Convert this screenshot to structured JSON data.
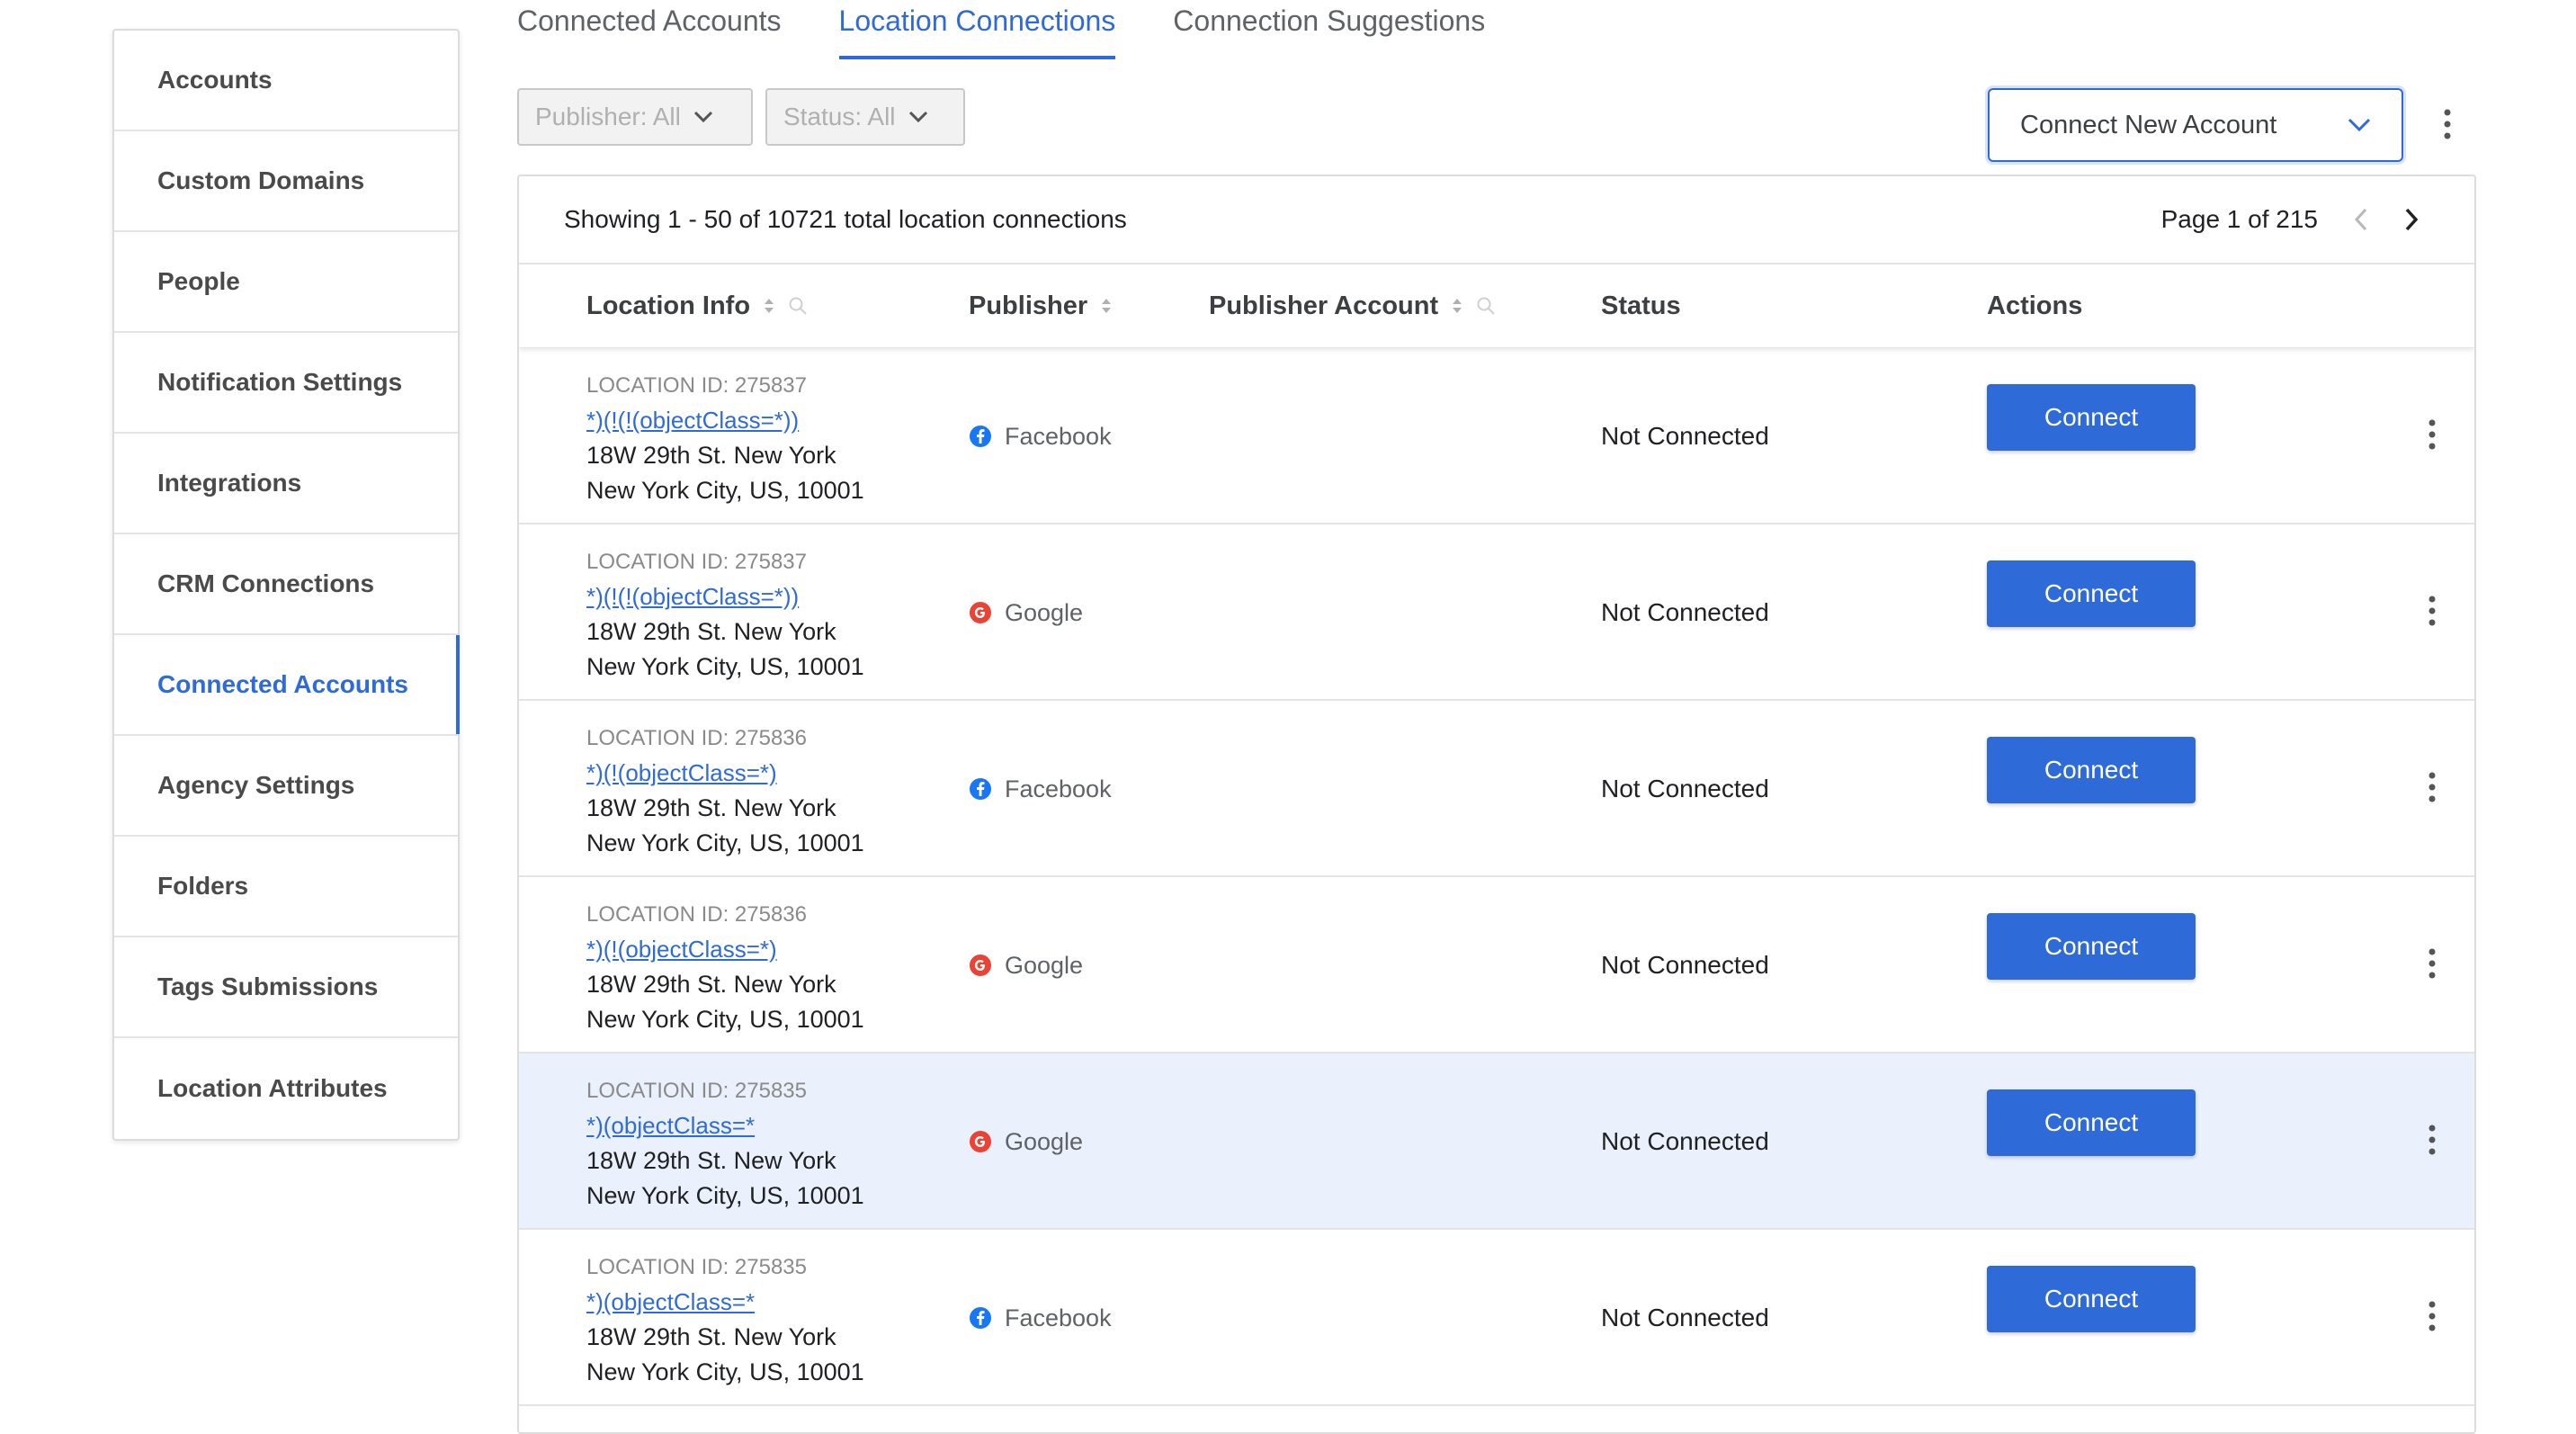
{
  "sidebar": {
    "items": [
      {
        "label": "Accounts"
      },
      {
        "label": "Custom Domains"
      },
      {
        "label": "People"
      },
      {
        "label": "Notification Settings"
      },
      {
        "label": "Integrations"
      },
      {
        "label": "CRM Connections"
      },
      {
        "label": "Connected Accounts",
        "active": true
      },
      {
        "label": "Agency Settings"
      },
      {
        "label": "Folders"
      },
      {
        "label": "Tags Submissions"
      },
      {
        "label": "Location Attributes"
      }
    ]
  },
  "tabs": [
    {
      "label": "Connected Accounts"
    },
    {
      "label": "Location Connections",
      "active": true
    },
    {
      "label": "Connection Suggestions"
    }
  ],
  "filters": {
    "publisher": "Publisher: All",
    "status": "Status: All"
  },
  "connect_new_label": "Connect New Account",
  "summary": {
    "showing": "Showing 1 - 50 of 10721 total location connections",
    "page": "Page 1 of 215"
  },
  "columns": {
    "location_info": "Location Info",
    "publisher": "Publisher",
    "publisher_account": "Publisher Account",
    "status": "Status",
    "actions": "Actions"
  },
  "rows": [
    {
      "loc_id": "LOCATION ID: 275837",
      "link": "*)(!(!(objectClass=*))",
      "addr1": "18W 29th St. New York",
      "addr2": "New York City, US, 10001",
      "publisher": "Facebook",
      "status": "Not Connected",
      "action": "Connect"
    },
    {
      "loc_id": "LOCATION ID: 275837",
      "link": "*)(!(!(objectClass=*))",
      "addr1": "18W 29th St. New York",
      "addr2": "New York City, US, 10001",
      "publisher": "Google",
      "status": "Not Connected",
      "action": "Connect"
    },
    {
      "loc_id": "LOCATION ID: 275836",
      "link": "*)(!(objectClass=*)",
      "addr1": "18W 29th St. New York",
      "addr2": "New York City, US, 10001",
      "publisher": "Facebook",
      "status": "Not Connected",
      "action": "Connect"
    },
    {
      "loc_id": "LOCATION ID: 275836",
      "link": "*)(!(objectClass=*)",
      "addr1": "18W 29th St. New York",
      "addr2": "New York City, US, 10001",
      "publisher": "Google",
      "status": "Not Connected",
      "action": "Connect"
    },
    {
      "loc_id": "LOCATION ID: 275835",
      "link": "*)(objectClass=*",
      "addr1": "18W 29th St. New York",
      "addr2": "New York City, US, 10001",
      "publisher": "Google",
      "status": "Not Connected",
      "action": "Connect",
      "highlighted": true
    },
    {
      "loc_id": "LOCATION ID: 275835",
      "link": "*)(objectClass=*",
      "addr1": "18W 29th St. New York",
      "addr2": "New York City, US, 10001",
      "publisher": "Facebook",
      "status": "Not Connected",
      "action": "Connect"
    }
  ],
  "colors": {
    "accent": "#2f6bd8",
    "facebook": "#1877f2",
    "google": "#ea4335",
    "highlight_row": "#ebf1fc"
  }
}
